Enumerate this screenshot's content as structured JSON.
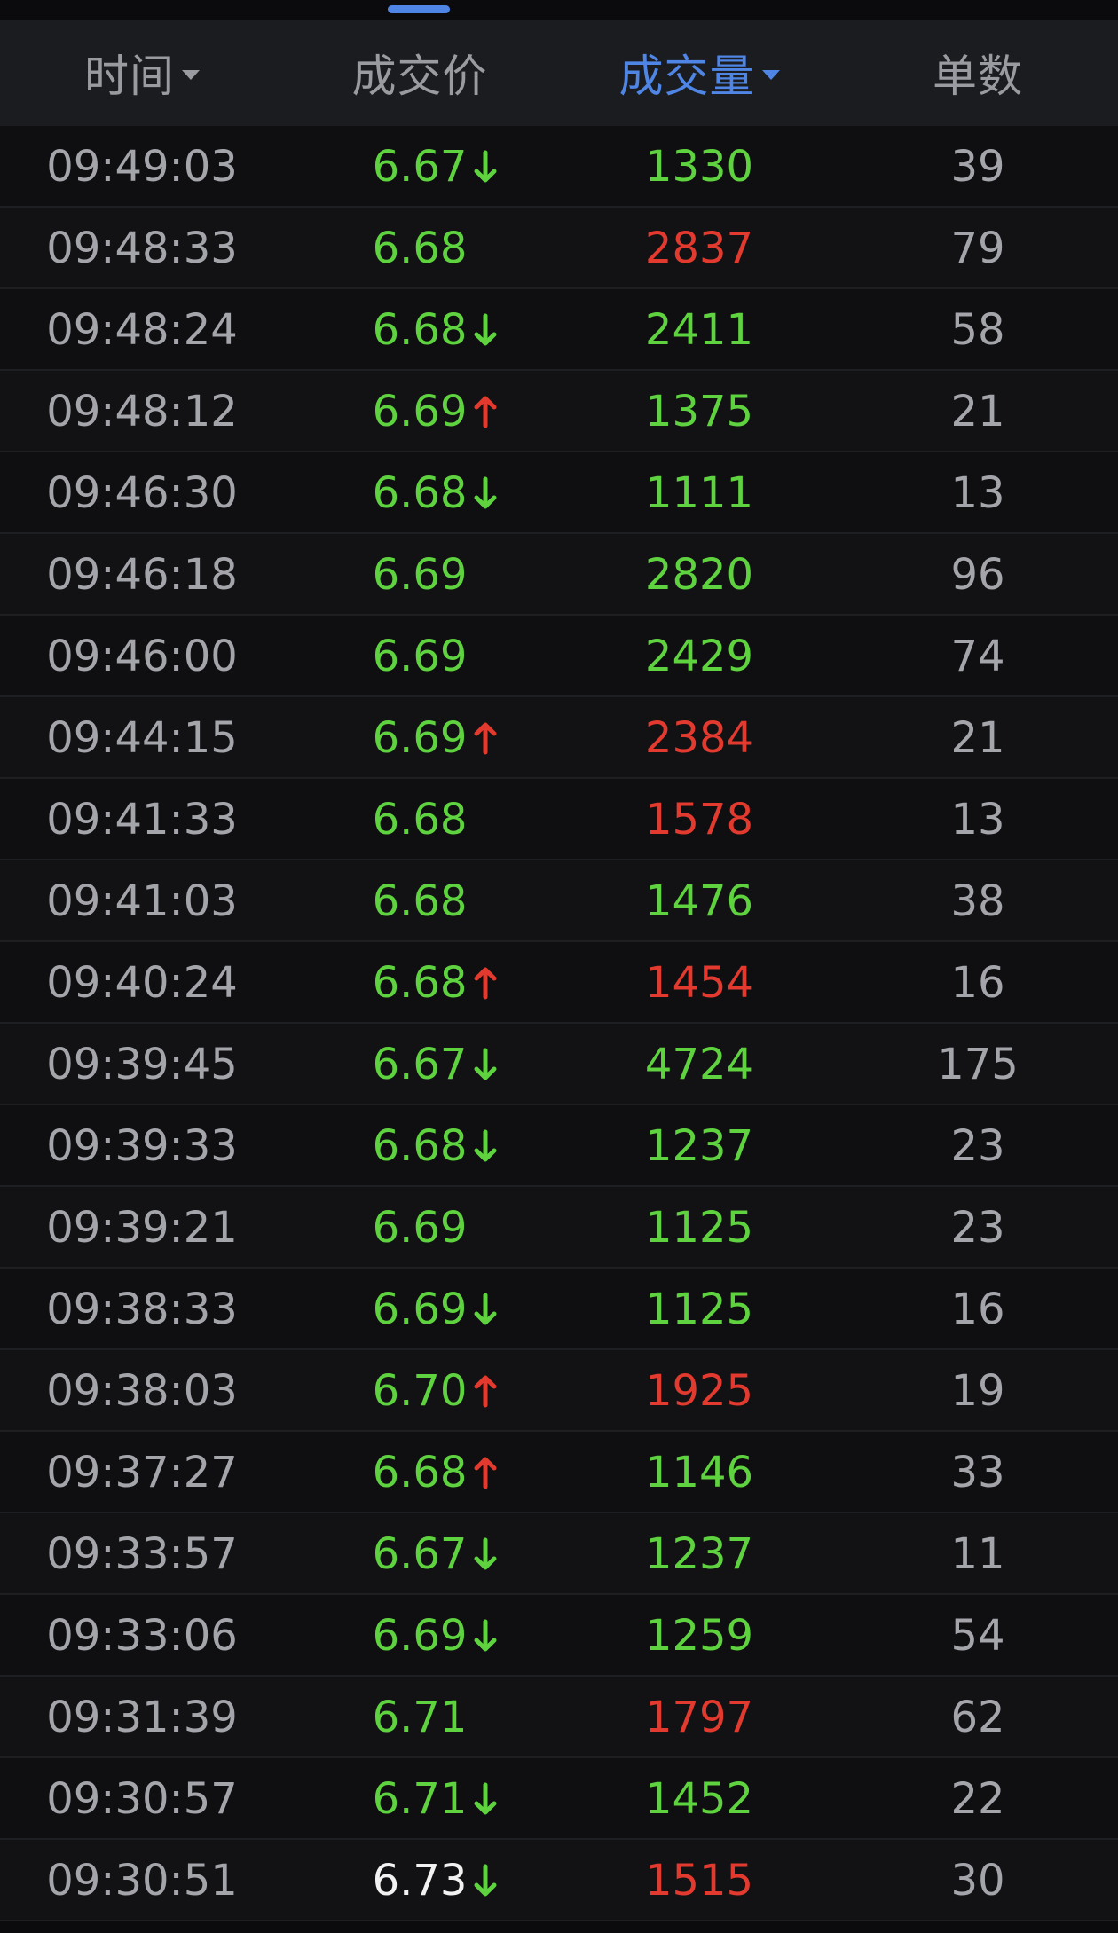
{
  "header": {
    "time_label": "时间",
    "price_label": "成交价",
    "volume_label": "成交量",
    "count_label": "单数"
  },
  "colors": {
    "up": "#e23a2e",
    "down": "#5fd33f",
    "neutral": "#f2f2f2",
    "accent": "#4f86e6"
  },
  "rows": [
    {
      "time": "09:49:03",
      "price": "6.67",
      "price_color": "green",
      "arrow": "down",
      "volume": "1330",
      "volume_color": "green",
      "count": "39"
    },
    {
      "time": "09:48:33",
      "price": "6.68",
      "price_color": "green",
      "arrow": "",
      "volume": "2837",
      "volume_color": "red",
      "count": "79"
    },
    {
      "time": "09:48:24",
      "price": "6.68",
      "price_color": "green",
      "arrow": "down",
      "volume": "2411",
      "volume_color": "green",
      "count": "58"
    },
    {
      "time": "09:48:12",
      "price": "6.69",
      "price_color": "green",
      "arrow": "up",
      "volume": "1375",
      "volume_color": "green",
      "count": "21"
    },
    {
      "time": "09:46:30",
      "price": "6.68",
      "price_color": "green",
      "arrow": "down",
      "volume": "1111",
      "volume_color": "green",
      "count": "13"
    },
    {
      "time": "09:46:18",
      "price": "6.69",
      "price_color": "green",
      "arrow": "",
      "volume": "2820",
      "volume_color": "green",
      "count": "96"
    },
    {
      "time": "09:46:00",
      "price": "6.69",
      "price_color": "green",
      "arrow": "",
      "volume": "2429",
      "volume_color": "green",
      "count": "74"
    },
    {
      "time": "09:44:15",
      "price": "6.69",
      "price_color": "green",
      "arrow": "up",
      "volume": "2384",
      "volume_color": "red",
      "count": "21"
    },
    {
      "time": "09:41:33",
      "price": "6.68",
      "price_color": "green",
      "arrow": "",
      "volume": "1578",
      "volume_color": "red",
      "count": "13"
    },
    {
      "time": "09:41:03",
      "price": "6.68",
      "price_color": "green",
      "arrow": "",
      "volume": "1476",
      "volume_color": "green",
      "count": "38"
    },
    {
      "time": "09:40:24",
      "price": "6.68",
      "price_color": "green",
      "arrow": "up",
      "volume": "1454",
      "volume_color": "red",
      "count": "16"
    },
    {
      "time": "09:39:45",
      "price": "6.67",
      "price_color": "green",
      "arrow": "down",
      "volume": "4724",
      "volume_color": "green",
      "count": "175"
    },
    {
      "time": "09:39:33",
      "price": "6.68",
      "price_color": "green",
      "arrow": "down",
      "volume": "1237",
      "volume_color": "green",
      "count": "23"
    },
    {
      "time": "09:39:21",
      "price": "6.69",
      "price_color": "green",
      "arrow": "",
      "volume": "1125",
      "volume_color": "green",
      "count": "23"
    },
    {
      "time": "09:38:33",
      "price": "6.69",
      "price_color": "green",
      "arrow": "down",
      "volume": "1125",
      "volume_color": "green",
      "count": "16"
    },
    {
      "time": "09:38:03",
      "price": "6.70",
      "price_color": "green",
      "arrow": "up",
      "volume": "1925",
      "volume_color": "red",
      "count": "19"
    },
    {
      "time": "09:37:27",
      "price": "6.68",
      "price_color": "green",
      "arrow": "up",
      "volume": "1146",
      "volume_color": "green",
      "count": "33"
    },
    {
      "time": "09:33:57",
      "price": "6.67",
      "price_color": "green",
      "arrow": "down",
      "volume": "1237",
      "volume_color": "green",
      "count": "11"
    },
    {
      "time": "09:33:06",
      "price": "6.69",
      "price_color": "green",
      "arrow": "down",
      "volume": "1259",
      "volume_color": "green",
      "count": "54"
    },
    {
      "time": "09:31:39",
      "price": "6.71",
      "price_color": "green",
      "arrow": "",
      "volume": "1797",
      "volume_color": "red",
      "count": "62"
    },
    {
      "time": "09:30:57",
      "price": "6.71",
      "price_color": "green",
      "arrow": "down",
      "volume": "1452",
      "volume_color": "green",
      "count": "22"
    },
    {
      "time": "09:30:51",
      "price": "6.73",
      "price_color": "white",
      "arrow": "down",
      "volume": "1515",
      "volume_color": "red",
      "count": "30"
    }
  ]
}
